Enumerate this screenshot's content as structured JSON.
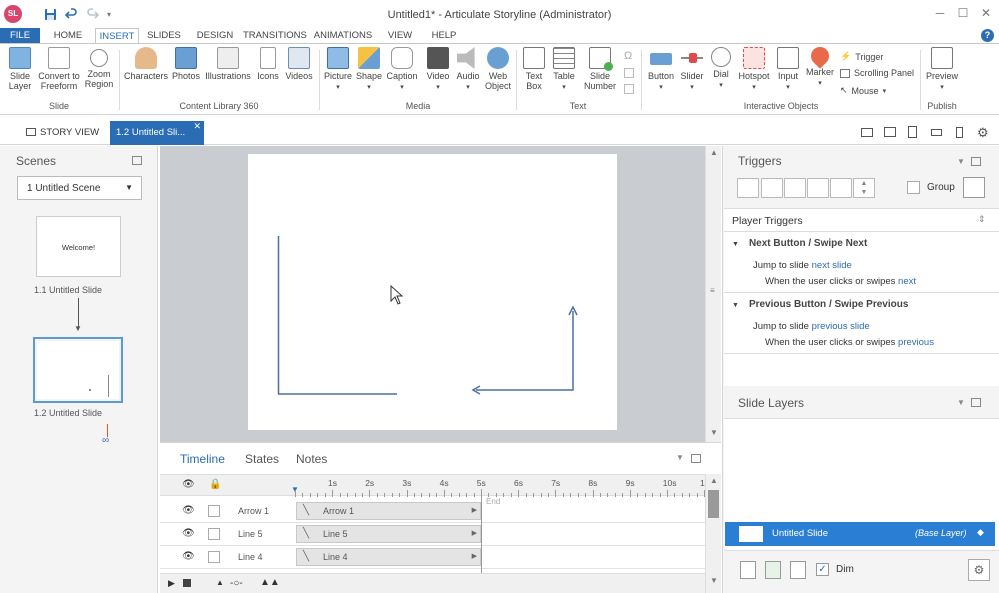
{
  "window": {
    "title": "Untitled1* - Articulate Storyline (Administrator)",
    "logo": "SL"
  },
  "tabs": [
    "FILE",
    "HOME",
    "INSERT",
    "SLIDES",
    "DESIGN",
    "TRANSITIONS",
    "ANIMATIONS",
    "VIEW",
    "HELP"
  ],
  "ribbon": {
    "slide_group": {
      "label": "Slide",
      "items": [
        "Slide Layer",
        "Convert to Freeform",
        "Zoom Region"
      ]
    },
    "content_group": {
      "label": "Content Library 360",
      "items": [
        "Characters",
        "Photos",
        "Illustrations",
        "Icons",
        "Videos"
      ]
    },
    "media_group": {
      "label": "Media",
      "items": [
        "Picture",
        "Shape",
        "Caption",
        "Video",
        "Audio",
        "Web Object"
      ]
    },
    "text_group": {
      "label": "Text",
      "items": [
        "Text Box",
        "Table",
        "Slide Number"
      ]
    },
    "interactive_group": {
      "label": "Interactive Objects",
      "items": [
        "Button",
        "Slider",
        "Dial",
        "Hotspot",
        "Input",
        "Marker"
      ],
      "small": [
        "Trigger",
        "Scrolling Panel",
        "Mouse"
      ]
    },
    "publish_group": {
      "label": "Publish",
      "items": [
        "Preview"
      ]
    }
  },
  "viewbar": {
    "story_view": "STORY VIEW",
    "slide_tab": "1.2 Untitled Sli..."
  },
  "scenes": {
    "title": "Scenes",
    "dropdown": "1 Untitled Scene",
    "slides": [
      {
        "label": "1.1 Untitled Slide",
        "thumb_text": "Welcome!"
      },
      {
        "label": "1.2 Untitled Slide",
        "thumb_text": ""
      }
    ]
  },
  "timeline": {
    "tabs": [
      "Timeline",
      "States",
      "Notes"
    ],
    "ticks": [
      "1s",
      "2s",
      "3s",
      "4s",
      "5s",
      "6s",
      "7s",
      "8s",
      "9s",
      "10s",
      "1"
    ],
    "end_label": "End",
    "rows": [
      {
        "name": "Arrow 1",
        "bar": "Arrow 1"
      },
      {
        "name": "Line 5",
        "bar": "Line 5"
      },
      {
        "name": "Line 4",
        "bar": "Line 4"
      }
    ]
  },
  "triggers": {
    "title": "Triggers",
    "group_label": "Group",
    "player_triggers": "Player Triggers",
    "sections": [
      {
        "header": "Next Button / Swipe Next",
        "action_prefix": "Jump to slide ",
        "action_link": "next slide",
        "cond_prefix": "When the user clicks or swipes ",
        "cond_link": "next"
      },
      {
        "header": "Previous Button / Swipe Previous",
        "action_prefix": "Jump to slide ",
        "action_link": "previous slide",
        "cond_prefix": "When the user clicks or swipes ",
        "cond_link": "previous"
      }
    ]
  },
  "layers": {
    "title": "Slide Layers",
    "base_name": "Untitled Slide",
    "base_tag": "(Base Layer)",
    "dim_label": "Dim"
  },
  "colors": {
    "accent": "#2a6db5",
    "arrow": "#4a6fa5"
  }
}
